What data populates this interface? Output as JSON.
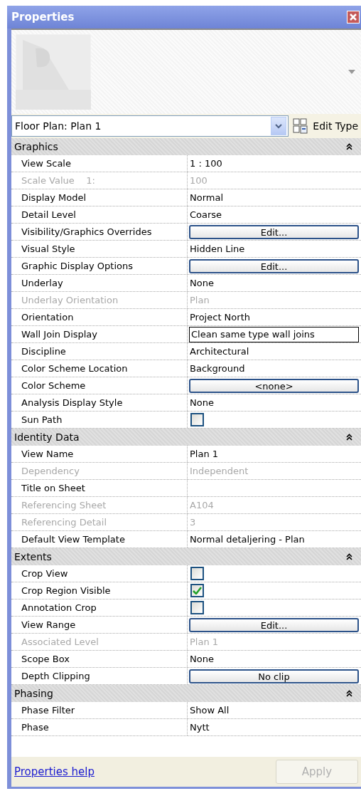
{
  "window": {
    "title": "Properties"
  },
  "type_selector": {
    "value": "Floor Plan: Plan 1"
  },
  "edit_type": {
    "label": "Edit Type"
  },
  "sections": [
    {
      "title": "Graphics",
      "expanded": true,
      "rows": [
        {
          "label": "View Scale",
          "kind": "text",
          "value": "1 : 100",
          "disabled": false
        },
        {
          "label": "Scale Value    1:",
          "kind": "text",
          "value": "100",
          "disabled": true
        },
        {
          "label": "Display Model",
          "kind": "text",
          "value": "Normal",
          "disabled": false
        },
        {
          "label": "Detail Level",
          "kind": "text",
          "value": "Coarse",
          "disabled": false
        },
        {
          "label": "Visibility/Graphics Overrides",
          "kind": "button",
          "value": "Edit...",
          "disabled": false
        },
        {
          "label": "Visual Style",
          "kind": "text",
          "value": "Hidden Line",
          "disabled": false
        },
        {
          "label": "Graphic Display Options",
          "kind": "button",
          "value": "Edit...",
          "disabled": false
        },
        {
          "label": "Underlay",
          "kind": "text",
          "value": "None",
          "disabled": false
        },
        {
          "label": "Underlay Orientation",
          "kind": "text",
          "value": "Plan",
          "disabled": true
        },
        {
          "label": "Orientation",
          "kind": "text",
          "value": "Project North",
          "disabled": false
        },
        {
          "label": "Wall Join Display",
          "kind": "field",
          "value": "Clean same type wall joins",
          "disabled": false
        },
        {
          "label": "Discipline",
          "kind": "text",
          "value": "Architectural",
          "disabled": false
        },
        {
          "label": "Color Scheme Location",
          "kind": "text",
          "value": "Background",
          "disabled": false
        },
        {
          "label": "Color Scheme",
          "kind": "button",
          "value": "<none>",
          "disabled": false
        },
        {
          "label": "Analysis Display Style",
          "kind": "text",
          "value": "None",
          "disabled": false
        },
        {
          "label": "Sun Path",
          "kind": "checkbox",
          "checked": false,
          "disabled": false
        }
      ]
    },
    {
      "title": "Identity Data",
      "expanded": true,
      "rows": [
        {
          "label": "View Name",
          "kind": "text",
          "value": "Plan 1",
          "disabled": false
        },
        {
          "label": "Dependency",
          "kind": "text",
          "value": "Independent",
          "disabled": true
        },
        {
          "label": "Title on Sheet",
          "kind": "text",
          "disabled": false
        },
        {
          "label": "Referencing Sheet",
          "kind": "text",
          "value": "A104",
          "disabled": true
        },
        {
          "label": "Referencing Detail",
          "kind": "text",
          "value": "3",
          "disabled": true
        },
        {
          "label": "Default View Template",
          "kind": "text",
          "value": "Normal detaljering - Plan",
          "disabled": false
        }
      ]
    },
    {
      "title": "Extents",
      "expanded": true,
      "rows": [
        {
          "label": "Crop View",
          "kind": "checkbox",
          "checked": false,
          "disabled": false
        },
        {
          "label": "Crop Region Visible",
          "kind": "checkbox",
          "checked": true,
          "disabled": false
        },
        {
          "label": "Annotation Crop",
          "kind": "checkbox",
          "checked": false,
          "disabled": false
        },
        {
          "label": "View Range",
          "kind": "button",
          "value": "Edit...",
          "disabled": false
        },
        {
          "label": "Associated Level",
          "kind": "text",
          "value": "Plan 1",
          "disabled": true
        },
        {
          "label": "Scope Box",
          "kind": "text",
          "value": "None",
          "disabled": false
        },
        {
          "label": "Depth Clipping",
          "kind": "button",
          "value": "No clip",
          "disabled": false
        }
      ]
    },
    {
      "title": "Phasing",
      "expanded": true,
      "rows": [
        {
          "label": "Phase Filter",
          "kind": "text",
          "value": "Show All",
          "disabled": false
        },
        {
          "label": "Phase",
          "kind": "text",
          "value": "Nytt",
          "disabled": false
        }
      ]
    }
  ],
  "footer": {
    "help_link": "Properties help",
    "apply": {
      "label": "Apply",
      "disabled": true
    }
  }
}
